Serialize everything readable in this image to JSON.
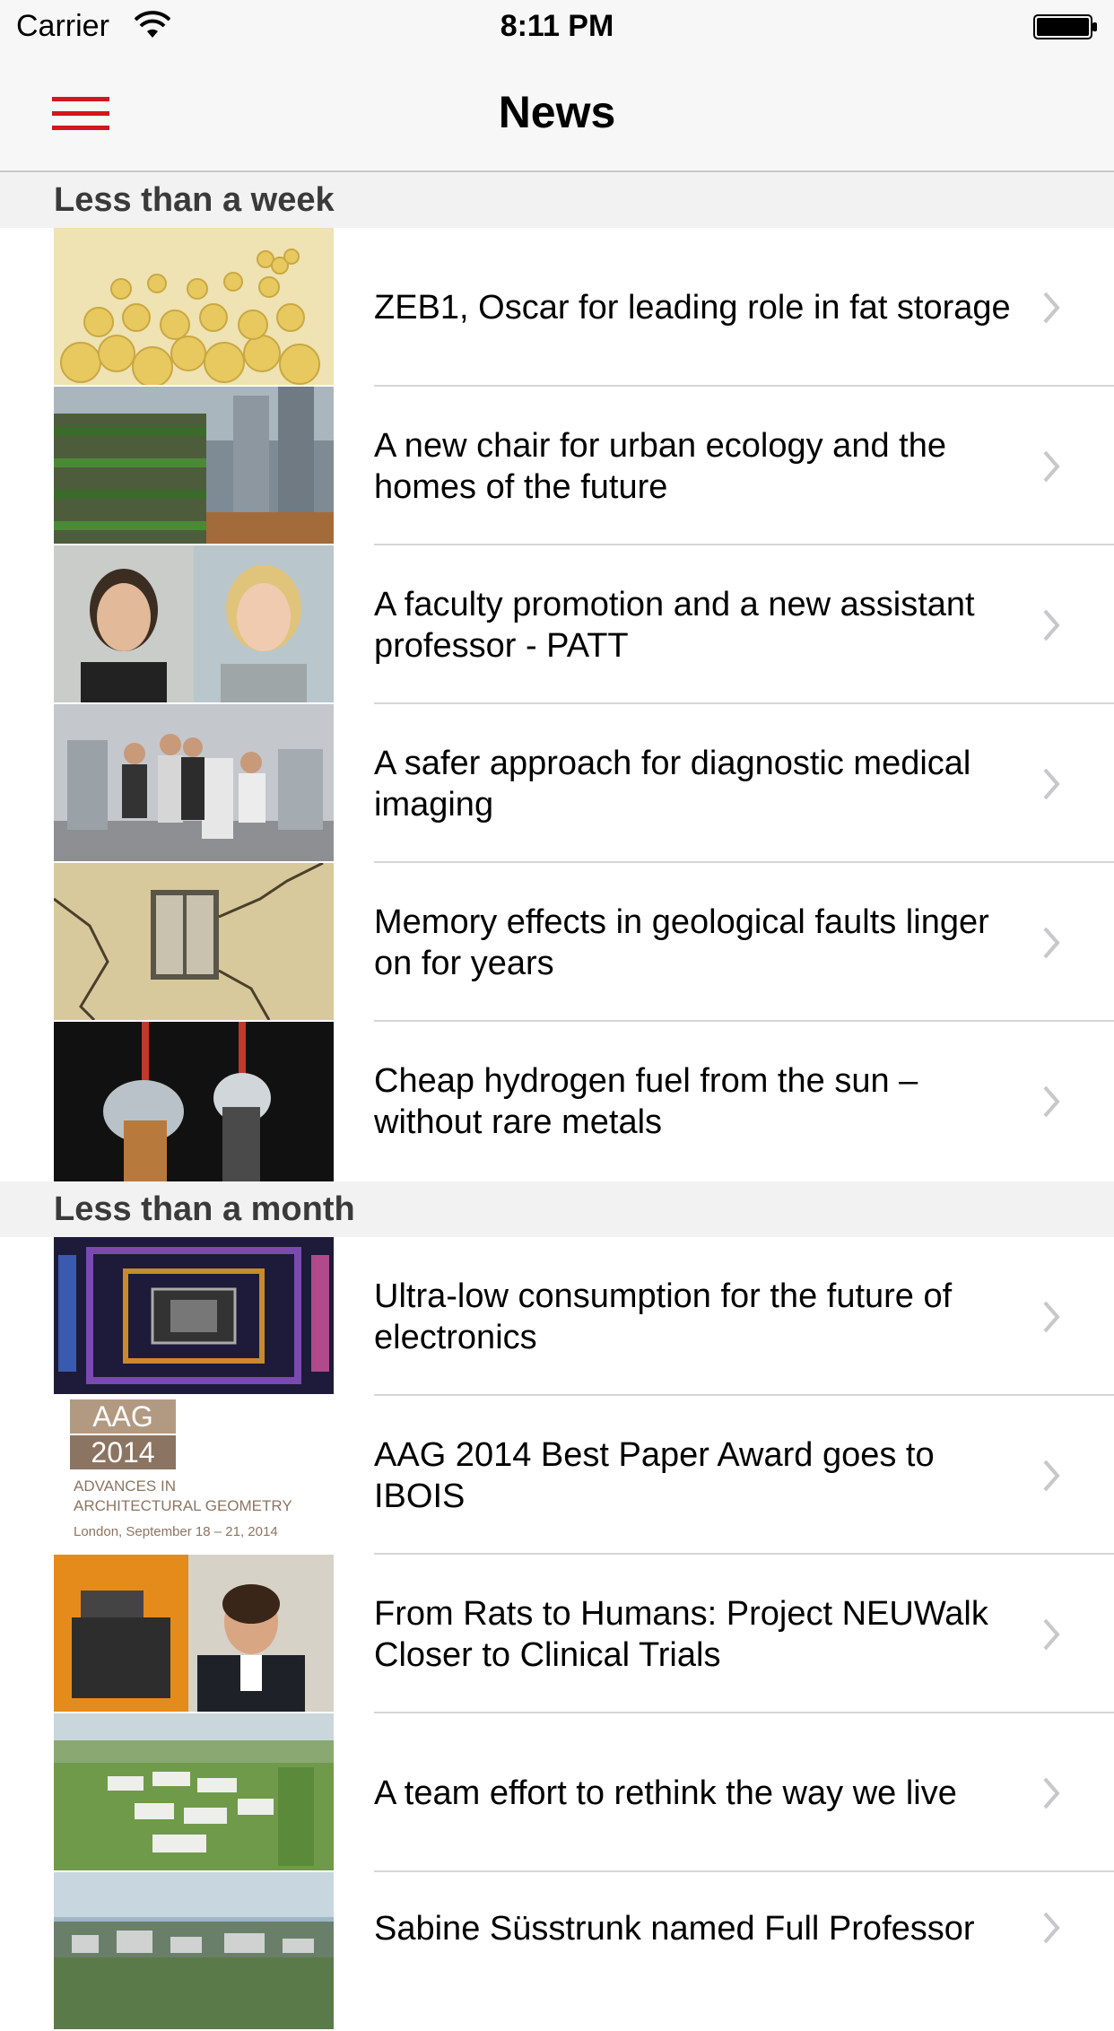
{
  "status_bar": {
    "carrier": "Carrier",
    "time": "8:11 PM"
  },
  "nav": {
    "title": "News",
    "menu_icon": "hamburger-menu-icon",
    "accent_color": "#d2161e"
  },
  "sections": [
    {
      "header": "Less than a week",
      "items": [
        {
          "title": "ZEB1, Oscar for leading role in fat storage",
          "image": "fat-cells-thumbnail"
        },
        {
          "title": "A new chair for urban ecology and the homes of the future",
          "image": "green-building-thumbnail"
        },
        {
          "title": "A faculty promotion and a new assistant professor - PATT",
          "image": "faculty-portraits-thumbnail"
        },
        {
          "title": "A safer approach for diagnostic medical imaging",
          "image": "lab-team-thumbnail"
        },
        {
          "title": "Memory effects in geological faults linger on for years",
          "image": "cracked-wall-thumbnail"
        },
        {
          "title": "Cheap hydrogen fuel from the sun – without rare metals",
          "image": "electrodes-thumbnail"
        }
      ]
    },
    {
      "header": "Less than a month",
      "items": [
        {
          "title": "Ultra-low consumption for the future of electronics",
          "image": "chip-tunnel-thumbnail"
        },
        {
          "title": "AAG 2014 Best Paper Award goes to IBOIS",
          "image": "aag-2014-logo"
        },
        {
          "title": "From Rats to Humans: Project NEUWalk Closer to Clinical Trials",
          "image": "lab-portrait-thumbnail"
        },
        {
          "title": "A team effort to rethink the way we live",
          "image": "campus-aerial-thumbnail"
        },
        {
          "title": "Sabine Süsstrunk named Full Professor",
          "image": "city-landscape-thumbnail"
        }
      ]
    }
  ],
  "aag_logo": {
    "line1": "AAG",
    "line2": "2014",
    "line3": "ADVANCES IN",
    "line4": "ARCHITECTURAL GEOMETRY",
    "line5": "London, September 18 – 21, 2014"
  }
}
